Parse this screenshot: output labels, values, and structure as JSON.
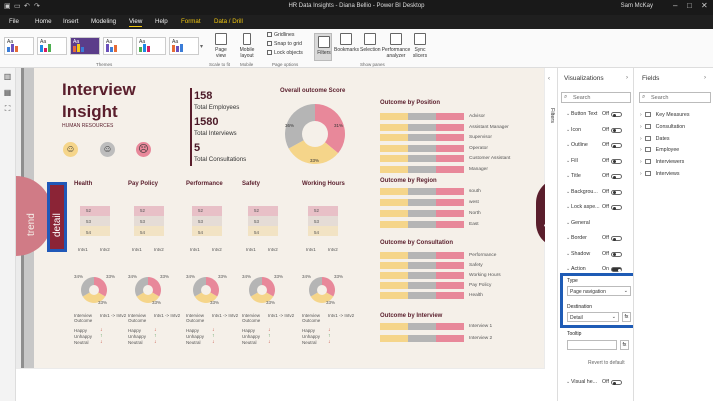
{
  "window": {
    "title": "HR Data Insights - Diana Bellio - Power BI Desktop",
    "user": "Sam McKay"
  },
  "menu": {
    "file": "File",
    "home": "Home",
    "insert": "Insert",
    "modeling": "Modeling",
    "view": "View",
    "help": "Help",
    "format": "Format",
    "data_drill": "Data / Drill"
  },
  "ribbon": {
    "themes_label": "Themes",
    "page_view": "Page view",
    "scale_label": "Scale to fit",
    "mobile_layout": "Mobile layout",
    "mobile_label": "Mobile",
    "gridlines": "Gridlines",
    "snap": "Snap to grid",
    "lock": "Lock objects",
    "page_options": "Page options",
    "filters": "Filters",
    "bookmarks": "Bookmarks",
    "selection": "Selection",
    "perf": "Performance analyzer",
    "sync": "Sync slicers",
    "show_panes": "Show panes",
    "theme_colors": [
      "#3b7dd8",
      "#6b4fbb",
      "#e66c37",
      "#4caf50",
      "#1e88e5",
      "#d81b60"
    ]
  },
  "report": {
    "title_line1": "Interview",
    "title_line2": "Insight",
    "subtitle": "HUMAN RESOURCES",
    "kpis": [
      {
        "value": "158",
        "label": "Total Employees"
      },
      {
        "value": "1580",
        "label": "Total Interviews"
      },
      {
        "value": "5",
        "label": "Total Consultations"
      }
    ],
    "donut": {
      "title": "Overall outcome Score",
      "slices": [
        {
          "label": "36%",
          "value": 36,
          "color": "#e8889a"
        },
        {
          "label": "31%",
          "value": 31,
          "color": "#f5d58a"
        },
        {
          "label": "33%",
          "value": 33,
          "color": "#b5b5b5"
        }
      ]
    },
    "categories": [
      "Health",
      "Pay Policy",
      "Performance",
      "Safety",
      "Working Hours"
    ],
    "mini_vals": [
      "52",
      "53",
      "54"
    ],
    "mini_x": [
      "Intv1",
      "Intv2"
    ],
    "mini_pie_pcts": [
      "34%",
      "33%",
      "33%"
    ],
    "legend_items": [
      "Interview Outcome",
      "Intv1 -> Intv2"
    ],
    "outcome_words": [
      "Happy",
      "Unhappy",
      "Neutral"
    ],
    "trend_tab": "trend",
    "detail_tab": "detail",
    "summary_tab": "summary",
    "position": {
      "title": "Outcome by Position",
      "rows": [
        "Advisor",
        "Assistant Manager",
        "Supervisor",
        "Operator",
        "Customer Assistant",
        "Manager"
      ]
    },
    "region": {
      "title": "Outcome by Region",
      "rows": [
        "south",
        "west",
        "North",
        "East"
      ]
    },
    "consultation": {
      "title": "Outcome by Consultation",
      "rows": [
        "Performance",
        "Safety",
        "Working Hours",
        "Pay Policy",
        "Health"
      ]
    },
    "interview": {
      "title": "Outcome by Interview",
      "rows": [
        "Interview 1",
        "Interview 2"
      ]
    },
    "colors": {
      "happy": "#f5d58a",
      "neutral": "#b5b5b5",
      "unhappy": "#e8889a",
      "title": "#5a1e2c"
    }
  },
  "visualizations": {
    "title": "Visualizations",
    "filters_label": "Filters",
    "search": "Search",
    "props": [
      {
        "name": "Button Text",
        "value": "Off"
      },
      {
        "name": "Icon",
        "value": "Off"
      },
      {
        "name": "Outline",
        "value": "Off"
      },
      {
        "name": "Fill",
        "value": "Off"
      },
      {
        "name": "Title",
        "value": "Off"
      },
      {
        "name": "Backgrou...",
        "value": "Off"
      },
      {
        "name": "Lock aspe...",
        "value": "Off"
      },
      {
        "name": "General",
        "value": ""
      },
      {
        "name": "Border",
        "value": "Off"
      },
      {
        "name": "Shadow",
        "value": "Off"
      },
      {
        "name": "Action",
        "value": "On"
      }
    ],
    "type_label": "Type",
    "type_value": "Page navigation",
    "dest_label": "Destination",
    "dest_value": "Detail",
    "tooltip_label": "Tooltip",
    "revert": "Revert to default",
    "visual_header": "Visual he...",
    "visual_header_value": "Off"
  },
  "fields": {
    "title": "Fields",
    "search": "Search",
    "items": [
      "Key Measures",
      "Consultation",
      "Dates",
      "Employee",
      "Interviewers",
      "Interviews"
    ]
  }
}
